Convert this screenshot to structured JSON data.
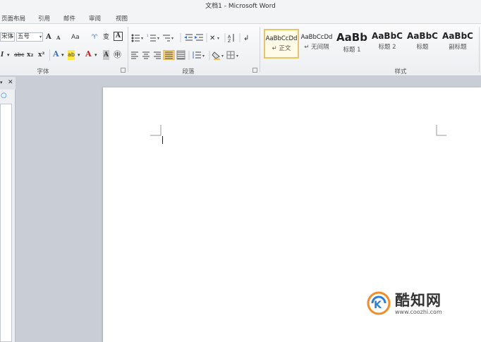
{
  "window": {
    "title": "文档1 - Microsoft Word"
  },
  "menu": {
    "tabs": [
      "页面布局",
      "引用",
      "邮件",
      "审阅",
      "视图"
    ]
  },
  "font_group": {
    "font_name": "宋体",
    "font_size": "五号",
    "grow": "A",
    "shrink": "A",
    "change_case": "Aa",
    "clear": "ᴬ",
    "phonetic": "㊥",
    "char_border": "A",
    "italic": "I",
    "strike": "abc",
    "subscript": "x₂",
    "superscript": "x²",
    "text_effect": "A",
    "highlight": "ab",
    "font_color": "A",
    "char_shading": "A",
    "enclose": "字",
    "label": "字体"
  },
  "paragraph_group": {
    "label": "段落"
  },
  "styles_group": {
    "label": "样式",
    "styles": [
      {
        "sample": "AaBbCcDd",
        "name": "↵ 正文",
        "selected": true
      },
      {
        "sample": "AaBbCcDd",
        "name": "↵ 无间隔",
        "selected": false
      },
      {
        "sample": "AaBb",
        "name": "标题 1",
        "selected": false
      },
      {
        "sample": "AaBbC",
        "name": "标题 2",
        "selected": false
      },
      {
        "sample": "AaBbC",
        "name": "标题",
        "selected": false
      },
      {
        "sample": "AaBbC",
        "name": "副标题",
        "selected": false
      }
    ]
  },
  "left_panel": {
    "close": "✕",
    "pin": "▾"
  },
  "watermark": {
    "name": "酷知网",
    "url": "www.coozhi.com"
  },
  "colors": {
    "accent_orange": "#f28c28",
    "accent_blue": "#2d7fd3",
    "highlight_yellow": "#ffe84a",
    "font_red": "#dd1111"
  }
}
